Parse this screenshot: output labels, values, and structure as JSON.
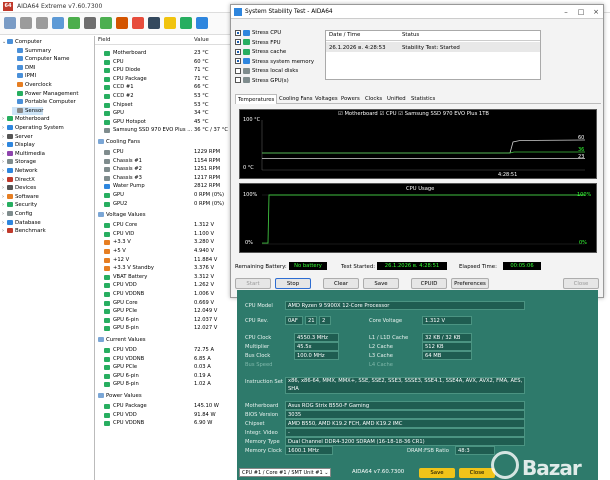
{
  "app": {
    "title": "AIDA64 Extreme v7.60.7300"
  },
  "tree": {
    "items": [
      {
        "label": "Computer",
        "indent": 0,
        "expand": "⌄",
        "color": "#4a90d9"
      },
      {
        "label": "Summary",
        "indent": 1,
        "color": "#4a90d9"
      },
      {
        "label": "Computer Name",
        "indent": 1,
        "color": "#4a90d9"
      },
      {
        "label": "DMI",
        "indent": 1,
        "color": "#4a90d9"
      },
      {
        "label": "IPMI",
        "indent": 1,
        "color": "#4a90d9"
      },
      {
        "label": "Overclock",
        "indent": 1,
        "color": "#e67e22"
      },
      {
        "label": "Power Management",
        "indent": 1,
        "color": "#27ae60"
      },
      {
        "label": "Portable Computer",
        "indent": 1,
        "color": "#4a90d9"
      },
      {
        "label": "Sensor",
        "indent": 1,
        "color": "#888888",
        "selected": true
      },
      {
        "label": "Motherboard",
        "indent": 0,
        "expand": "›",
        "color": "#27ae60"
      },
      {
        "label": "Operating System",
        "indent": 0,
        "expand": "›",
        "color": "#2e86de"
      },
      {
        "label": "Server",
        "indent": 0,
        "expand": "›",
        "color": "#555555"
      },
      {
        "label": "Display",
        "indent": 0,
        "expand": "›",
        "color": "#2e86de"
      },
      {
        "label": "Multimedia",
        "indent": 0,
        "expand": "›",
        "color": "#8e44ad"
      },
      {
        "label": "Storage",
        "indent": 0,
        "expand": "›",
        "color": "#7f8c8d"
      },
      {
        "label": "Network",
        "indent": 0,
        "expand": "›",
        "color": "#2e86de"
      },
      {
        "label": "DirectX",
        "indent": 0,
        "expand": "›",
        "color": "#c0392b"
      },
      {
        "label": "Devices",
        "indent": 0,
        "expand": "›",
        "color": "#555555"
      },
      {
        "label": "Software",
        "indent": 0,
        "expand": "›",
        "color": "#e67e22"
      },
      {
        "label": "Security",
        "indent": 0,
        "expand": "›",
        "color": "#27ae60"
      },
      {
        "label": "Config",
        "indent": 0,
        "expand": "›",
        "color": "#7f8c8d"
      },
      {
        "label": "Database",
        "indent": 0,
        "expand": "›",
        "color": "#2e86de"
      },
      {
        "label": "Benchmark",
        "indent": 0,
        "expand": "›",
        "color": "#c0392b"
      }
    ]
  },
  "table": {
    "col_field": "Field",
    "col_value": "Value",
    "groups": [
      {
        "label": "",
        "rows": [
          {
            "f": "Motherboard",
            "v": "23 °C",
            "c": "#27ae60"
          },
          {
            "f": "CPU",
            "v": "60 °C",
            "c": "#27ae60"
          },
          {
            "f": "CPU Diode",
            "v": "71 °C",
            "c": "#27ae60"
          },
          {
            "f": "CPU Package",
            "v": "71 °C",
            "c": "#27ae60"
          },
          {
            "f": "CCD #1",
            "v": "66 °C",
            "c": "#27ae60"
          },
          {
            "f": "CCD #2",
            "v": "53 °C",
            "c": "#27ae60"
          },
          {
            "f": "Chipset",
            "v": "53 °C",
            "c": "#27ae60"
          },
          {
            "f": "GPU",
            "v": "34 °C",
            "c": "#27ae60"
          },
          {
            "f": "GPU Hotspot",
            "v": "45 °C",
            "c": "#27ae60"
          },
          {
            "f": "Samsung SSD 970 EVO Plus ...",
            "v": "36 °C / 37 °C",
            "c": "#7f8c8d"
          }
        ]
      },
      {
        "label": "Cooling Fans",
        "rows": [
          {
            "f": "CPU",
            "v": "1229 RPM",
            "c": "#7f8c8d"
          },
          {
            "f": "Chassis #1",
            "v": "1154 RPM",
            "c": "#7f8c8d"
          },
          {
            "f": "Chassis #2",
            "v": "1251 RPM",
            "c": "#7f8c8d"
          },
          {
            "f": "Chassis #3",
            "v": "1217 RPM",
            "c": "#7f8c8d"
          },
          {
            "f": "Water Pump",
            "v": "2812 RPM",
            "c": "#2e86de"
          },
          {
            "f": "GPU",
            "v": "0 RPM  (0%)",
            "c": "#27ae60"
          },
          {
            "f": "GPU2",
            "v": "0 RPM  (0%)",
            "c": "#27ae60"
          }
        ]
      },
      {
        "label": "Voltage Values",
        "rows": [
          {
            "f": "CPU Core",
            "v": "1.312 V",
            "c": "#27ae60"
          },
          {
            "f": "CPU VID",
            "v": "1.100 V",
            "c": "#27ae60"
          },
          {
            "f": "+3.3 V",
            "v": "3.280 V",
            "c": "#e67e22"
          },
          {
            "f": "+5 V",
            "v": "4.940 V",
            "c": "#e67e22"
          },
          {
            "f": "+12 V",
            "v": "11.884 V",
            "c": "#e67e22"
          },
          {
            "f": "+3.3 V Standby",
            "v": "3.376 V",
            "c": "#e67e22"
          },
          {
            "f": "VBAT Battery",
            "v": "3.312 V",
            "c": "#27ae60"
          },
          {
            "f": "CPU VDD",
            "v": "1.262 V",
            "c": "#27ae60"
          },
          {
            "f": "CPU VDDNB",
            "v": "1.006 V",
            "c": "#27ae60"
          },
          {
            "f": "GPU Core",
            "v": "0.669 V",
            "c": "#27ae60"
          },
          {
            "f": "GPU PCIe",
            "v": "12.049 V",
            "c": "#27ae60"
          },
          {
            "f": "GPU 6-pin",
            "v": "12.037 V",
            "c": "#27ae60"
          },
          {
            "f": "GPU 8-pin",
            "v": "12.027 V",
            "c": "#27ae60"
          }
        ]
      },
      {
        "label": "Current Values",
        "rows": [
          {
            "f": "CPU VDD",
            "v": "72.75 A",
            "c": "#27ae60"
          },
          {
            "f": "CPU VDDNB",
            "v": "6.85 A",
            "c": "#27ae60"
          },
          {
            "f": "GPU PCIe",
            "v": "0.03 A",
            "c": "#27ae60"
          },
          {
            "f": "GPU 6-pin",
            "v": "0.19 A",
            "c": "#27ae60"
          },
          {
            "f": "GPU 8-pin",
            "v": "1.02 A",
            "c": "#27ae60"
          }
        ]
      },
      {
        "label": "Power Values",
        "rows": [
          {
            "f": "CPU Package",
            "v": "145.10 W",
            "c": "#27ae60"
          },
          {
            "f": "CPU VDD",
            "v": "91.84 W",
            "c": "#27ae60"
          },
          {
            "f": "CPU VDDNB",
            "v": "6.90 W",
            "c": "#27ae60"
          }
        ]
      }
    ]
  },
  "stability": {
    "title": "System Stability Test - AIDA64",
    "checks": [
      {
        "label": "Stress CPU",
        "on": true,
        "color": "#2e86de"
      },
      {
        "label": "Stress FPU",
        "on": true,
        "color": "#27ae60"
      },
      {
        "label": "Stress cache",
        "on": true,
        "color": "#27ae60"
      },
      {
        "label": "Stress system memory",
        "on": true,
        "color": "#2e86de"
      },
      {
        "label": "Stress local disks",
        "on": false,
        "color": "#7f8c8d"
      },
      {
        "label": "Stress GPU(s)",
        "on": false,
        "color": "#7f8c8d"
      }
    ],
    "status_table": {
      "col_date": "Date / Time",
      "col_status": "Status",
      "date": "26.1.2026 в. 4:28:53",
      "status": "Stability Test: Started"
    },
    "tabs": [
      "Temperatures",
      "Cooling Fans",
      "Voltages",
      "Powers",
      "Clocks",
      "Unified",
      "Statistics"
    ],
    "temp_graph": {
      "ymax": "100 °C",
      "ymin": "0 °C",
      "time": "4:28:51",
      "legend": [
        "Motherboard",
        "CPU",
        "Samsung SSD 970 EVO Plus 1TB"
      ],
      "values": [
        "60",
        "36",
        "23"
      ],
      "color": "#3fbf3f"
    },
    "usage_graph": {
      "title": "CPU Usage",
      "ymax": "100%",
      "ymin": "0%",
      "right_max": "100%",
      "right_min": "0%",
      "color": "#3fbf3f"
    },
    "battery_label": "Remaining Battery:",
    "battery_value": "No battery",
    "started_label": "Test Started:",
    "started_value": "26.1.2026 в. 4:28:51",
    "elapsed_label": "Elapsed Time:",
    "elapsed_value": "00:05:06",
    "buttons": {
      "start": "Start",
      "stop": "Stop",
      "clear": "Clear",
      "save": "Save",
      "cpuid": "CPUID",
      "preferences": "Preferences",
      "close": "Close"
    }
  },
  "cpuid": {
    "rows": [
      {
        "k": "CPU Model",
        "v": "AMD Ryzen 9 5900X 12-Core Processor"
      },
      {
        "k": "CPU Rev.",
        "v1": "0AF",
        "v2": "21",
        "v3": "2",
        "k2": "Core Voltage",
        "v4": "1.312 V"
      },
      {
        "k": "CPU Clock",
        "v": "4550.3 MHz",
        "k2": "L1 / L1D Cache",
        "v2": "32 KB / 32 KB"
      },
      {
        "k": "Multiplier",
        "v": "45.5x",
        "k2": "L2 Cache",
        "v2": "512 KB"
      },
      {
        "k": "Bus Clock",
        "v": "100.0 MHz",
        "k2": "L3 Cache",
        "v2": "64 MB"
      },
      {
        "k": "Bus Speed",
        "v": "",
        "k2": "L4 Cache",
        "v2": ""
      },
      {
        "k": "Instruction Set",
        "v": "x86, x86-64, MMX, MMX+, SSE, SSE2, SSE3, SSSE3, SSE4.1, SSE4A, AVX, AVX2, FMA, AES, SHA"
      },
      {
        "k": "Motherboard",
        "v": "Asus ROG Strix B550-F Gaming"
      },
      {
        "k": "BIOS Version",
        "v": "3035"
      },
      {
        "k": "Chipset",
        "v": "AMD B550, AMD K19.2 FCH, AMD K19.2 IMC"
      },
      {
        "k": "Integr. Video",
        "v": "-"
      },
      {
        "k": "Memory Type",
        "v": "Dual Channel DDR4-3200 SDRAM  (16-18-18-36 CR1)"
      },
      {
        "k": "Memory Clock",
        "v": "1600.1 MHz",
        "k2": "DRAM:FSB Ratio",
        "v2": "48:3"
      }
    ],
    "selector": "CPU #1 / Core #1 / SMT Unit #1",
    "version": "AIDA64 v7.60.7300",
    "save": "Save",
    "close": "Close"
  },
  "watermark": "Bazar"
}
